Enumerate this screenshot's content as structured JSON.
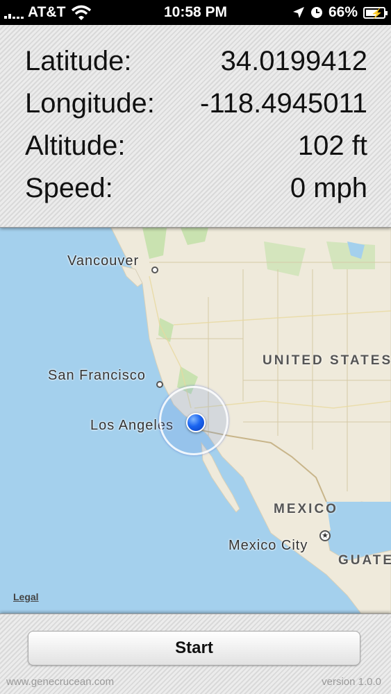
{
  "status_bar": {
    "carrier": "AT&T",
    "time": "10:58 PM",
    "battery": "66%",
    "battery_level": 0.66,
    "icons": [
      "signal-icon",
      "wifi-icon",
      "location-arrow-icon",
      "alarm-clock-icon",
      "battery-charging-icon"
    ]
  },
  "info": {
    "latitude_label": "Latitude:",
    "latitude_value": "34.0199412",
    "longitude_label": "Longitude:",
    "longitude_value": "-118.4945011",
    "altitude_label": "Altitude:",
    "altitude_value": "102 ft",
    "speed_label": "Speed:",
    "speed_value": "0 mph"
  },
  "map": {
    "cities": [
      "Vancouver",
      "San Francisco",
      "Los Angeles",
      "Mexico City"
    ],
    "countries": [
      "UNITED STATES",
      "MEXICO",
      "GUATE"
    ],
    "legal": "Legal",
    "colors": {
      "water": "#a4d0ed",
      "land": "#efeadb",
      "park": "#c9e2b0",
      "pin": "#1a64f0"
    }
  },
  "footer": {
    "start_label": "Start",
    "website": "www.genecrucean.com",
    "version": "version 1.0.0"
  }
}
